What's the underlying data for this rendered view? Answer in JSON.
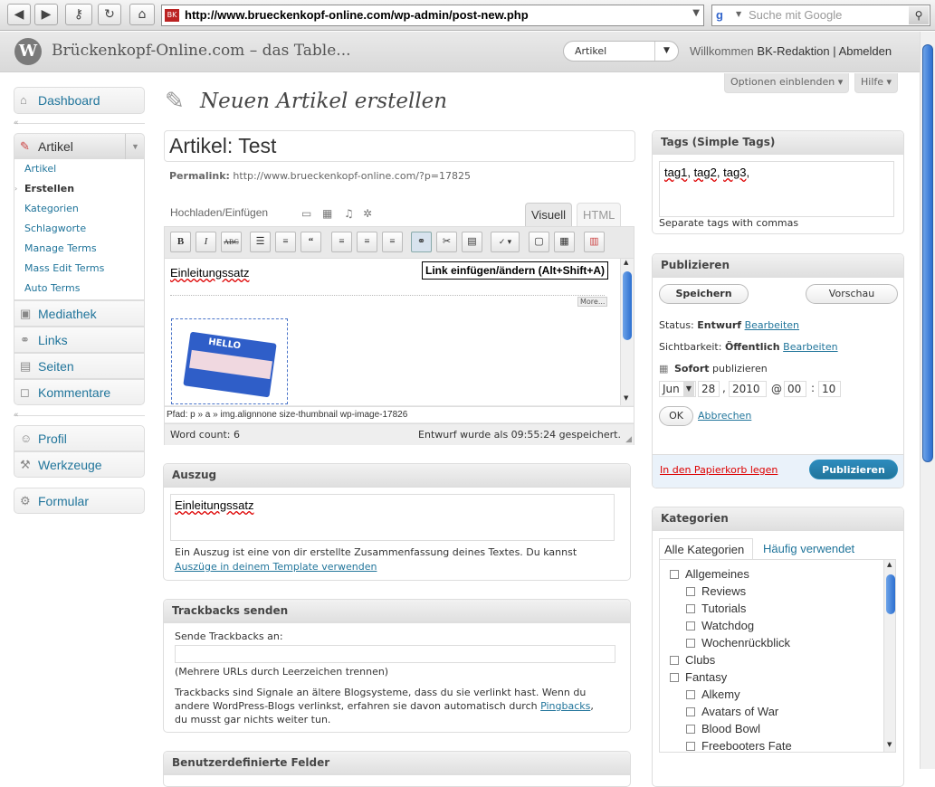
{
  "browser": {
    "url": "http://www.brueckenkopf-online.com/wp-admin/post-new.php",
    "search_placeholder": "Suche mit Google",
    "search_engine_letter": "g"
  },
  "header": {
    "logo_letter": "W",
    "site_title": "Brückenkopf-Online.com – das Table...",
    "favorites_selected": "Artikel",
    "welcome": "Willkommen",
    "user": "BK-Redaktion",
    "separator": "|",
    "logout": "Abmelden"
  },
  "screen_options": {
    "options": "Optionen einblenden",
    "help": "Hilfe"
  },
  "sidebar": {
    "dashboard": "Dashboard",
    "posts": "Artikel",
    "posts_sub": [
      "Artikel",
      "Erstellen",
      "Kategorien",
      "Schlagworte",
      "Manage Terms",
      "Mass Edit Terms",
      "Auto Terms"
    ],
    "media": "Mediathek",
    "links": "Links",
    "pages": "Seiten",
    "comments": "Kommentare",
    "profile": "Profil",
    "tools": "Werkzeuge",
    "form": "Formular"
  },
  "main": {
    "page_title": "Neuen Artikel erstellen",
    "post_title": "Artikel: Test",
    "permalink_label": "Permalink:",
    "permalink_url": "http://www.brueckenkopf-online.com/?p=17825",
    "upload_label": "Hochladen/Einfügen",
    "tab_visual": "Visuell",
    "tab_html": "HTML",
    "editor_text": "Einleitungssatz",
    "more_label": "More...",
    "image_text": "HELLO",
    "path": "Pfad: p » a » img.alignnone size-thumbnail wp-image-17826",
    "word_count": "Word count: 6",
    "draft_saved": "Entwurf wurde als 09:55:24 gespeichert.",
    "tooltip": "Link einfügen/ändern (Alt+Shift+A)"
  },
  "excerpt": {
    "title": "Auszug",
    "text": "Einleitungssatz",
    "help1": "Ein Auszug ist eine von dir erstellte Zusammenfassung deines Textes. Du kannst",
    "help_link": "Auszüge in deinem Template verwenden"
  },
  "trackbacks": {
    "title": "Trackbacks senden",
    "label": "Sende Trackbacks an:",
    "hint": "(Mehrere URLs durch Leerzeichen trennen)",
    "desc1": "Trackbacks sind Signale an ältere Blogsysteme, dass du sie verlinkt hast. Wenn du",
    "desc2": "andere WordPress-Blogs verlinkst, erfahren sie davon automatisch durch",
    "desc_link": "Pingbacks",
    "desc_comma": ",",
    "desc3": "du musst gar nichts weiter tun."
  },
  "custom_fields": {
    "title": "Benutzerdefinierte Felder"
  },
  "tags": {
    "title": "Tags (Simple Tags)",
    "tag1": "tag1",
    "tag2": "tag2",
    "tag3": "tag3",
    "sep": ",",
    "hint": "Separate tags with commas"
  },
  "publish": {
    "title": "Publizieren",
    "save": "Speichern",
    "preview": "Vorschau",
    "status_label": "Status:",
    "status_value": "Entwurf",
    "edit": "Bearbeiten",
    "visibility_label": "Sichtbarkeit:",
    "visibility_value": "Öffentlich",
    "immediately": "Sofort",
    "publish_word": "publizieren",
    "month": "Jun",
    "day": "28",
    "year": "2010",
    "at": "@",
    "hour": "00",
    "colon": ":",
    "minute": "10",
    "comma": ",",
    "ok": "OK",
    "cancel": "Abbrechen",
    "trash": "In den Papierkorb legen",
    "publish_button": "Publizieren"
  },
  "categories": {
    "title": "Kategorien",
    "tab_all": "Alle Kategorien",
    "tab_popular": "Häufig verwendet",
    "items": [
      {
        "label": "Allgemeines",
        "level": 0
      },
      {
        "label": "Reviews",
        "level": 1
      },
      {
        "label": "Tutorials",
        "level": 1
      },
      {
        "label": "Watchdog",
        "level": 1
      },
      {
        "label": "Wochenrückblick",
        "level": 1
      },
      {
        "label": "Clubs",
        "level": 0
      },
      {
        "label": "Fantasy",
        "level": 0
      },
      {
        "label": "Alkemy",
        "level": 1
      },
      {
        "label": "Avatars of War",
        "level": 1
      },
      {
        "label": "Blood Bowl",
        "level": 1
      },
      {
        "label": "Freebooters Fate",
        "level": 1
      }
    ]
  },
  "colors": {
    "link": "#21759b",
    "publish_button": "#21759b",
    "trash": "#d00"
  }
}
